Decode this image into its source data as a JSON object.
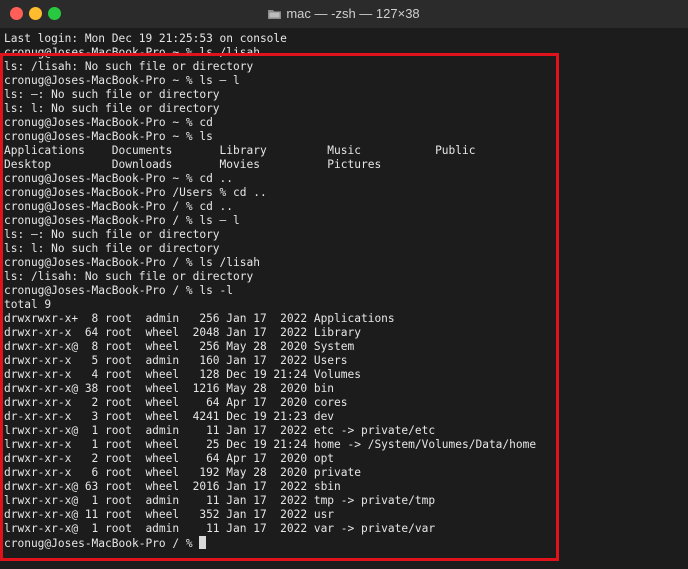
{
  "window": {
    "title": "mac — -zsh — 127×38",
    "highlight_color": "#e0121c"
  },
  "terminal": {
    "prompt_final": "cronug@Joses-MacBook-Pro / % ",
    "lines": [
      "Last login: Mon Dec 19 21:25:53 on console",
      "cronug@Joses-MacBook-Pro ~ % ls /lisah",
      "ls: /lisah: No such file or directory",
      "cronug@Joses-MacBook-Pro ~ % ls – l",
      "ls: –: No such file or directory",
      "ls: l: No such file or directory",
      "cronug@Joses-MacBook-Pro ~ % cd",
      "cronug@Joses-MacBook-Pro ~ % ls",
      "Applications    Documents       Library         Music           Public",
      "Desktop         Downloads       Movies          Pictures",
      "cronug@Joses-MacBook-Pro ~ % cd ..",
      "cronug@Joses-MacBook-Pro /Users % cd ..",
      "cronug@Joses-MacBook-Pro / % cd ..",
      "cronug@Joses-MacBook-Pro / % ls – l",
      "ls: –: No such file or directory",
      "ls: l: No such file or directory",
      "cronug@Joses-MacBook-Pro / % ls /lisah",
      "ls: /lisah: No such file or directory",
      "cronug@Joses-MacBook-Pro / % ls -l",
      "total 9",
      "drwxrwxr-x+  8 root  admin   256 Jan 17  2022 Applications",
      "drwxr-xr-x  64 root  wheel  2048 Jan 17  2022 Library",
      "drwxr-xr-x@  8 root  wheel   256 May 28  2020 System",
      "drwxr-xr-x   5 root  admin   160 Jan 17  2022 Users",
      "drwxr-xr-x   4 root  wheel   128 Dec 19 21:24 Volumes",
      "drwxr-xr-x@ 38 root  wheel  1216 May 28  2020 bin",
      "drwxr-xr-x   2 root  wheel    64 Apr 17  2020 cores",
      "dr-xr-xr-x   3 root  wheel  4241 Dec 19 21:23 dev",
      "lrwxr-xr-x@  1 root  admin    11 Jan 17  2022 etc -> private/etc",
      "lrwxr-xr-x   1 root  wheel    25 Dec 19 21:24 home -> /System/Volumes/Data/home",
      "drwxr-xr-x   2 root  wheel    64 Apr 17  2020 opt",
      "drwxr-xr-x   6 root  wheel   192 May 28  2020 private",
      "drwxr-xr-x@ 63 root  wheel  2016 Jan 17  2022 sbin",
      "lrwxr-xr-x@  1 root  admin    11 Jan 17  2022 tmp -> private/tmp",
      "drwxr-xr-x@ 11 root  wheel   352 Jan 17  2022 usr",
      "lrwxr-xr-x@  1 root  admin    11 Jan 17  2022 var -> private/var"
    ]
  }
}
